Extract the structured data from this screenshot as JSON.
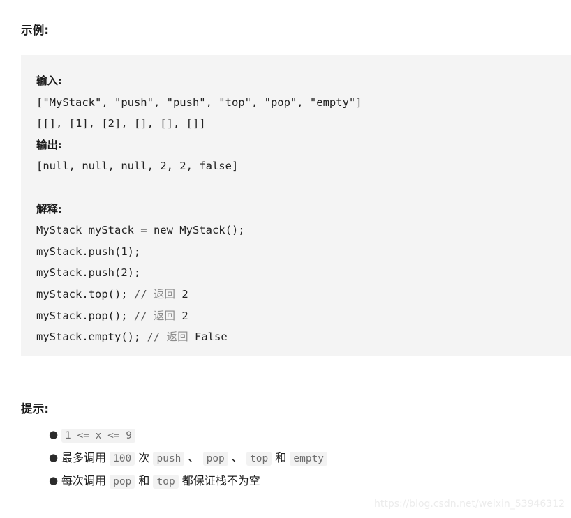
{
  "example": {
    "heading": "示例:",
    "code_lines": [
      {
        "kind": "cjk-label",
        "text": "输入:"
      },
      {
        "kind": "code",
        "text": "[\"MyStack\", \"push\", \"push\", \"top\", \"pop\", \"empty\"]"
      },
      {
        "kind": "code",
        "text": "[[], [1], [2], [], [], []]"
      },
      {
        "kind": "cjk-label",
        "text": "输出:"
      },
      {
        "kind": "code",
        "text": "[null, null, null, 2, 2, false]"
      },
      {
        "kind": "blank",
        "text": ""
      },
      {
        "kind": "cjk-label",
        "text": "解释:"
      },
      {
        "kind": "code",
        "text": "MyStack myStack = new MyStack();"
      },
      {
        "kind": "code",
        "text": "myStack.push(1);"
      },
      {
        "kind": "code",
        "text": "myStack.push(2);"
      },
      {
        "kind": "code-comment",
        "code": "myStack.top(); ",
        "slash": "// ",
        "comment": "返回",
        "value": " 2"
      },
      {
        "kind": "code-comment",
        "code": "myStack.pop(); ",
        "slash": "// ",
        "comment": "返回",
        "value": " 2"
      },
      {
        "kind": "code-comment",
        "code": "myStack.empty(); ",
        "slash": "// ",
        "comment": "返回",
        "value": " False"
      }
    ]
  },
  "hints": {
    "heading": "提示:",
    "bullet_glyph": "●",
    "items": [
      {
        "parts": [
          {
            "type": "code",
            "text": "1 <= x <= 9"
          }
        ]
      },
      {
        "parts": [
          {
            "type": "text",
            "text": "最多调用 "
          },
          {
            "type": "code",
            "text": "100"
          },
          {
            "type": "text",
            "text": " 次 "
          },
          {
            "type": "code",
            "text": "push"
          },
          {
            "type": "text",
            "text": " 、 "
          },
          {
            "type": "code",
            "text": "pop"
          },
          {
            "type": "text",
            "text": " 、 "
          },
          {
            "type": "code",
            "text": "top"
          },
          {
            "type": "text",
            "text": " 和 "
          },
          {
            "type": "code",
            "text": "empty"
          }
        ]
      },
      {
        "parts": [
          {
            "type": "text",
            "text": "每次调用 "
          },
          {
            "type": "code",
            "text": "pop"
          },
          {
            "type": "text",
            "text": " 和 "
          },
          {
            "type": "code",
            "text": "top"
          },
          {
            "type": "text",
            "text": " 都保证栈不为空"
          }
        ]
      }
    ]
  },
  "watermark": {
    "text": "https://blog.csdn.net/weixin_53946312"
  },
  "colors": {
    "code_block_background": "#f4f4f4",
    "inline_code_background": "#f2f2f2",
    "inline_code_text": "#6e6e6e",
    "body_text": "#1f1f1f",
    "comment_text": "#8c8c8c",
    "watermark_text": "#ececec"
  }
}
